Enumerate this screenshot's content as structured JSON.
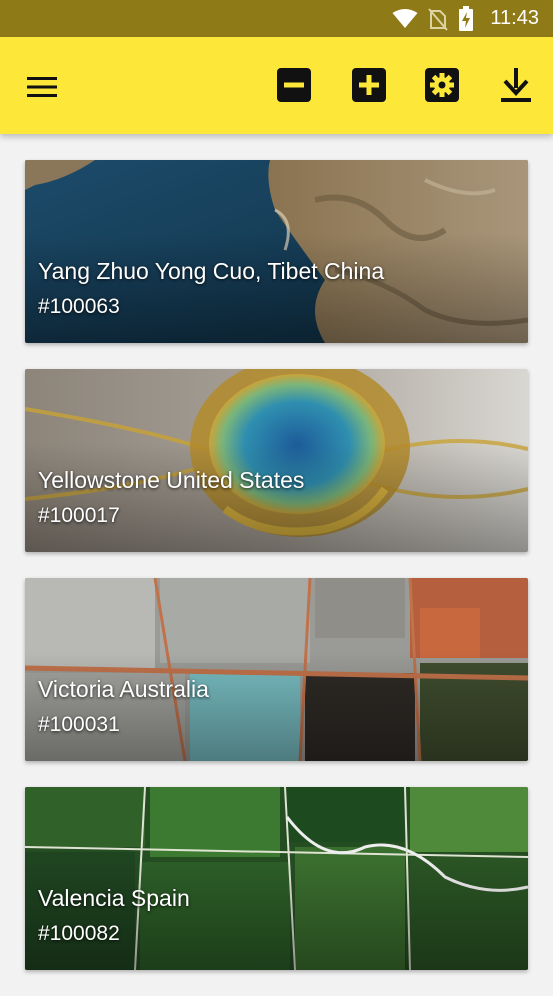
{
  "status_bar": {
    "time": "11:43",
    "icons": [
      "wifi-icon",
      "no-sim-icon",
      "battery-charging-icon"
    ]
  },
  "toolbar": {
    "menu_icon": "hamburger-menu-icon",
    "actions": [
      "zoom-out-icon",
      "zoom-in-icon",
      "settings-icon",
      "download-icon"
    ],
    "color": "#fde83a"
  },
  "cards": [
    {
      "title": "Yang Zhuo Yong Cuo, Tibet China",
      "code": "#100063"
    },
    {
      "title": "Yellowstone United States",
      "code": "#100017"
    },
    {
      "title": "Victoria Australia",
      "code": "#100031"
    },
    {
      "title": "Valencia Spain",
      "code": "#100082"
    }
  ],
  "colors": {
    "status_bar": "#8f7a18",
    "toolbar": "#fde83a",
    "background": "#f2f2f2"
  }
}
